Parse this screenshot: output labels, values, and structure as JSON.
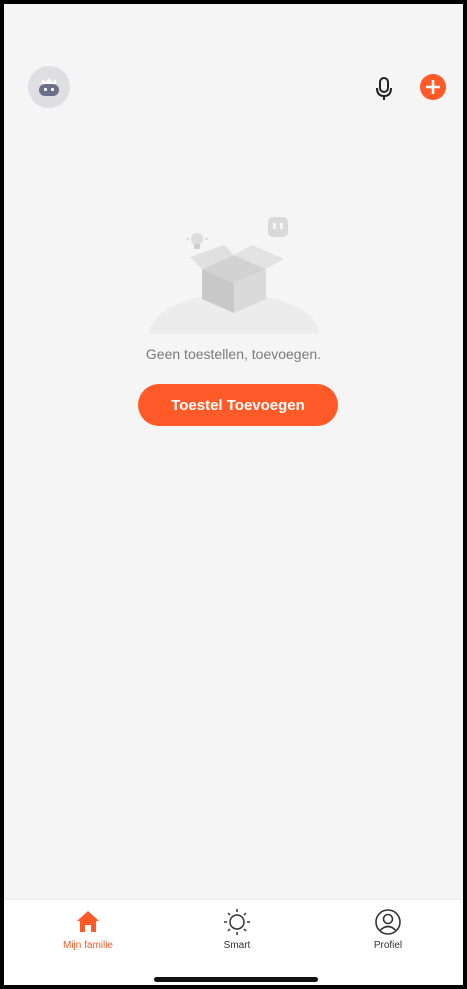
{
  "header": {
    "avatar_icon": "robot-avatar-icon",
    "mic_icon": "microphone-icon",
    "add_icon": "plus-icon"
  },
  "empty_state": {
    "illustration": "empty-box-illustration",
    "message": "Geen toestellen, toevoegen.",
    "button_label": "Toestel Toevoegen"
  },
  "tabbar": {
    "tabs": [
      {
        "label": "Mijn familie",
        "icon": "home-icon",
        "active": true
      },
      {
        "label": "Smart",
        "icon": "sun-icon",
        "active": false
      },
      {
        "label": "Profiel",
        "icon": "user-circle-icon",
        "active": false
      }
    ]
  },
  "colors": {
    "accent": "#ff5a28",
    "background": "#f5f5f5"
  }
}
